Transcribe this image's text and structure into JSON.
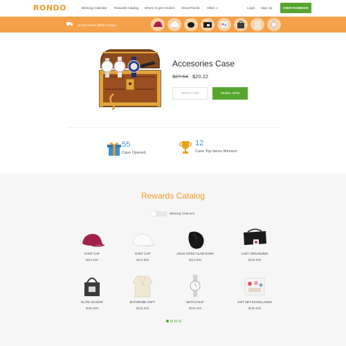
{
  "nav": {
    "logo": "RONDO",
    "links": [
      "Winning Calendar",
      "Rewards Catalog",
      "Where to get rondors",
      "About Rondo",
      "Other"
    ],
    "login": "Login",
    "signup": "Sign Up",
    "cta": "OVER FACEBOOK"
  },
  "strip": {
    "text": "At Your Home Within 2 Days.",
    "thumbnails": [
      "cap-icon",
      "white-cap-icon",
      "mouse-icon",
      "bag-icon",
      "gift-set-icon",
      "handbag-icon",
      "bathrobe-icon",
      "watch-icon"
    ]
  },
  "hero": {
    "title": "Accesories Case",
    "old_price": "$27.54",
    "new_price": "$20.22",
    "open_label": "OPEN CASE",
    "spin_label": "WHEEL SPIN"
  },
  "stats": [
    {
      "value": "55",
      "label": "Case Opened",
      "icon": "gift-icon"
    },
    {
      "value": "12",
      "label": "Case Top Items Winners",
      "icon": "trophy-icon"
    }
  ],
  "catalog": {
    "title": "Rewards Catalog",
    "toggle_label": "Winning Chances",
    "items": [
      {
        "name": "GANT CAP",
        "price": "$112.500",
        "icon": "cap-icon"
      },
      {
        "name": "GANT CAP",
        "price": "$112.500",
        "icon": "white-cap-icon"
      },
      {
        "name": "ASUS STRIX CLAW DARK",
        "price": "$112.500",
        "icon": "mouse-icon"
      },
      {
        "name": "LADY ORGANIZER",
        "price": "$125.000",
        "icon": "organizer-icon"
      },
      {
        "name": "ELITE LEANOR",
        "price": "$250.000",
        "icon": "handbag-icon"
      },
      {
        "name": "BATHROBE SOFT",
        "price": "$325.000",
        "icon": "bathrobe-icon"
      },
      {
        "name": "WATCH NAF",
        "price": "$375.000",
        "icon": "watch-icon"
      },
      {
        "name": "GIFT SET EXCELLANCE",
        "price": "$250.000",
        "icon": "gift-set-icon"
      }
    ],
    "pager": {
      "pages": 4,
      "current": 1
    }
  },
  "colors": {
    "accent": "#f39a2b",
    "strip": "#f5a14a",
    "green": "#56a52f",
    "stat_blue": "#3a8fc8"
  }
}
